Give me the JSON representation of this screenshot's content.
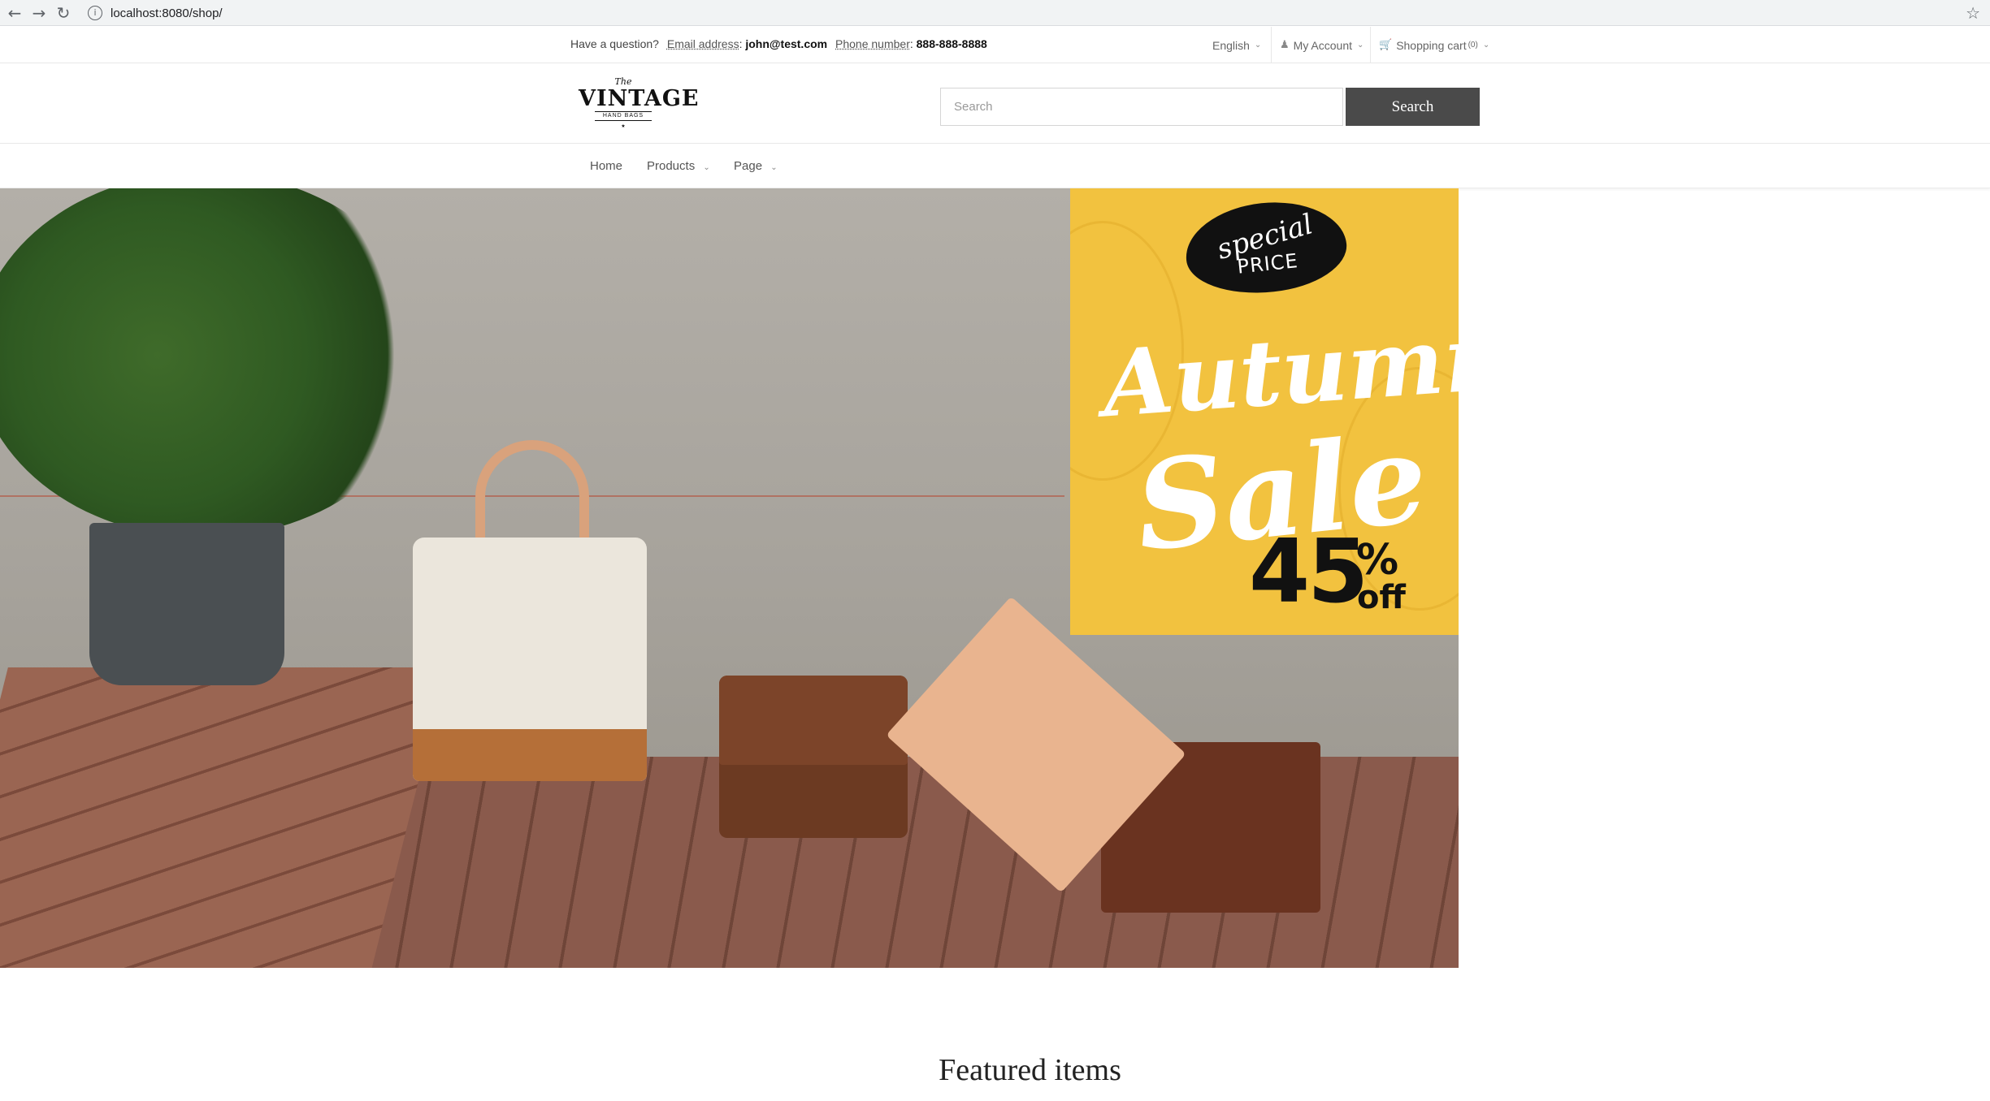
{
  "browser": {
    "url": "localhost:8080/shop/",
    "back_icon": "arrow-left-icon",
    "forward_icon": "arrow-right-icon",
    "reload_icon": "reload-icon",
    "star_icon": "star-icon"
  },
  "topbar": {
    "question": "Have a question?",
    "email_label": "Email address",
    "email_value": "john@test.com",
    "phone_label": "Phone number",
    "phone_value": "888-888-8888",
    "language": "English",
    "account": "My Account",
    "cart": "Shopping cart",
    "cart_count": "(0)"
  },
  "header": {
    "logo_the": "The",
    "logo_name": "VINTAGE",
    "logo_sub": "HAND BAGS",
    "search_placeholder": "Search",
    "search_button": "Search"
  },
  "nav": {
    "items": [
      {
        "label": "Home"
      },
      {
        "label": "Products"
      },
      {
        "label": "Page"
      }
    ]
  },
  "promo": {
    "badge_top": "special",
    "badge_bottom": "PRICE",
    "line1": "Autumn",
    "line2": "Sale",
    "discount": "45",
    "percent": "%",
    "off": "off"
  },
  "featured": {
    "title": "Featured items"
  },
  "colors": {
    "search_button_bg": "#4a4a4a",
    "promo_bg": "#f2c23f",
    "text_dark": "#222222"
  }
}
